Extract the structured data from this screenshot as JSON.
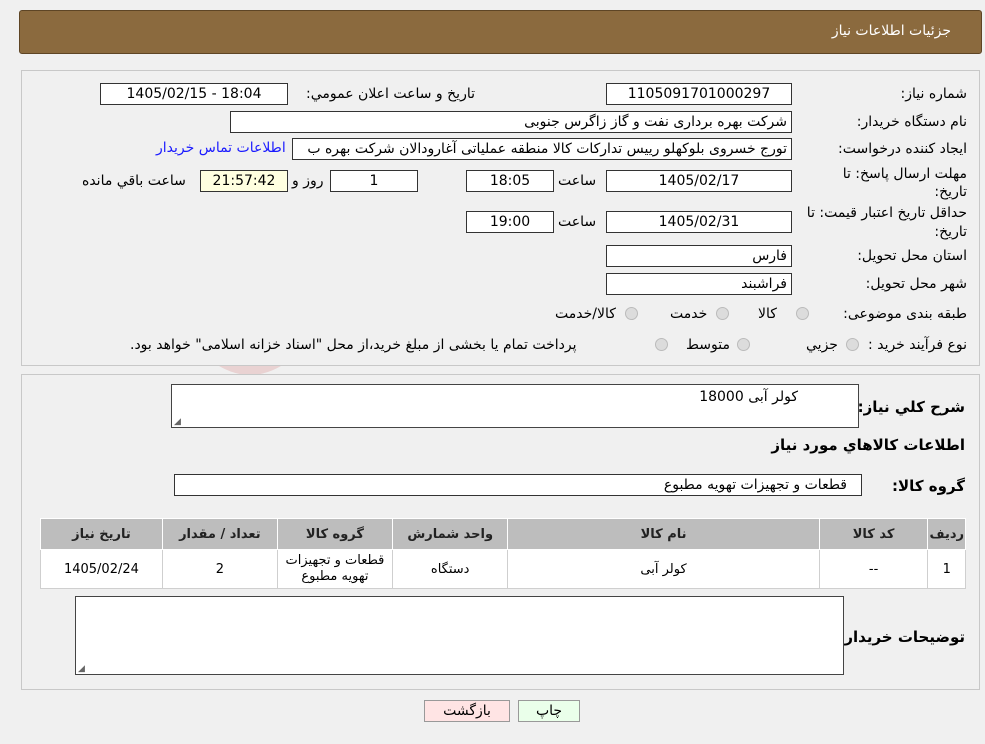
{
  "header": {
    "title": "جزئیات اطلاعات نیاز"
  },
  "watermark": "AriaTender.neT",
  "form": {
    "need_number_label": "شماره نیاز:",
    "need_number": "1105091701000297",
    "announce_label": "تاريخ و ساعت اعلان عمومي:",
    "announce_value": "1405/02/15 - 18:04",
    "buyer_org_label": "نام دستگاه خريدار:",
    "buyer_org": "شرکت بهره برداری نفت و گاز زاگرس جنوبی",
    "requester_label": "ايجاد کننده درخواست:",
    "requester": "تورج خسروی بلوکهلو رییس تدارکات کالا منطقه عملیاتی آغارودالان شرکت بهره ب",
    "contact_link": "اطلاعات تماس خريدار",
    "deadline_label_1": "مهلت ارسال پاسخ: تا",
    "deadline_label_2": "تاريخ:",
    "deadline_date": "1405/02/17",
    "time_label": "ساعت",
    "deadline_time": "18:05",
    "days_value": "1",
    "days_label": "روز و",
    "remaining_time": "21:57:42",
    "remaining_label": "ساعت باقي مانده",
    "validity_label_1": "حداقل تاريخ اعتبار قيمت: تا",
    "validity_label_2": "تاريخ:",
    "validity_date": "1405/02/31",
    "validity_time": "19:00",
    "province_label": "استان محل تحويل:",
    "province": "فارس",
    "city_label": "شهر محل تحويل:",
    "city": "فراشبند",
    "category_label": "طبقه بندی موضوعی:",
    "category_options": [
      "کالا",
      "خدمت",
      "کالا/خدمت"
    ],
    "process_label": "نوع فرآيند خريد :",
    "process_options": [
      "جزيي",
      "متوسط"
    ],
    "process_note": "پرداخت تمام يا بخشی از مبلغ خريد،از محل \"اسناد خزانه اسلامی\" خواهد بود."
  },
  "summary": {
    "desc_label": "شرح کلي نياز:",
    "desc_value": "کولر آبی 18000",
    "goods_info_label": "اطلاعات کالاهاي مورد نياز",
    "group_label": "گروه کالا:",
    "group_value": "قطعات و تجهیزات تهویه مطبوع",
    "table_headers": [
      "رديف",
      "کد کالا",
      "نام کالا",
      "واحد شمارش",
      "گروه کالا",
      "تعداد / مقدار",
      "تاريخ نياز"
    ],
    "rows": [
      [
        "1",
        "--",
        "کولر آبی",
        "دستگاه",
        "قطعات و تجهیزات تهویه مطبوع",
        "2",
        "1405/02/24"
      ]
    ],
    "buyer_notes_label": "توضيحات خريدار:"
  },
  "buttons": {
    "print": "چاپ",
    "back": "بازگشت"
  }
}
